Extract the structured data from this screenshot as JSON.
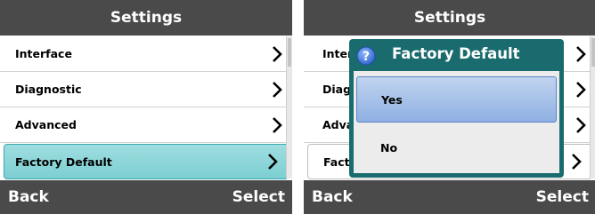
{
  "left_screen": {
    "title": "Settings",
    "items": [
      {
        "label": "Interface"
      },
      {
        "label": "Diagnostic"
      },
      {
        "label": "Advanced"
      },
      {
        "label": "Factory Default",
        "selected": true
      }
    ],
    "bottom": {
      "left": "Back",
      "right": "Select"
    }
  },
  "right_screen": {
    "title": "Settings",
    "items": [
      {
        "label": "Interface"
      },
      {
        "label": "Diagnostic"
      },
      {
        "label": "Advanced"
      },
      {
        "label": "Factory Default"
      }
    ],
    "bottom": {
      "left": "Back",
      "right": "Select"
    },
    "dialog": {
      "icon": "question-icon",
      "title": "Factory Default",
      "options": [
        {
          "label": "Yes",
          "selected": true
        },
        {
          "label": "No",
          "selected": false
        }
      ]
    }
  },
  "colors": {
    "bar": "#4a4a4a",
    "selection": "#8ad6d9",
    "dialog": "#1a6b6e",
    "dialog_selection": "#a9c2ea"
  }
}
